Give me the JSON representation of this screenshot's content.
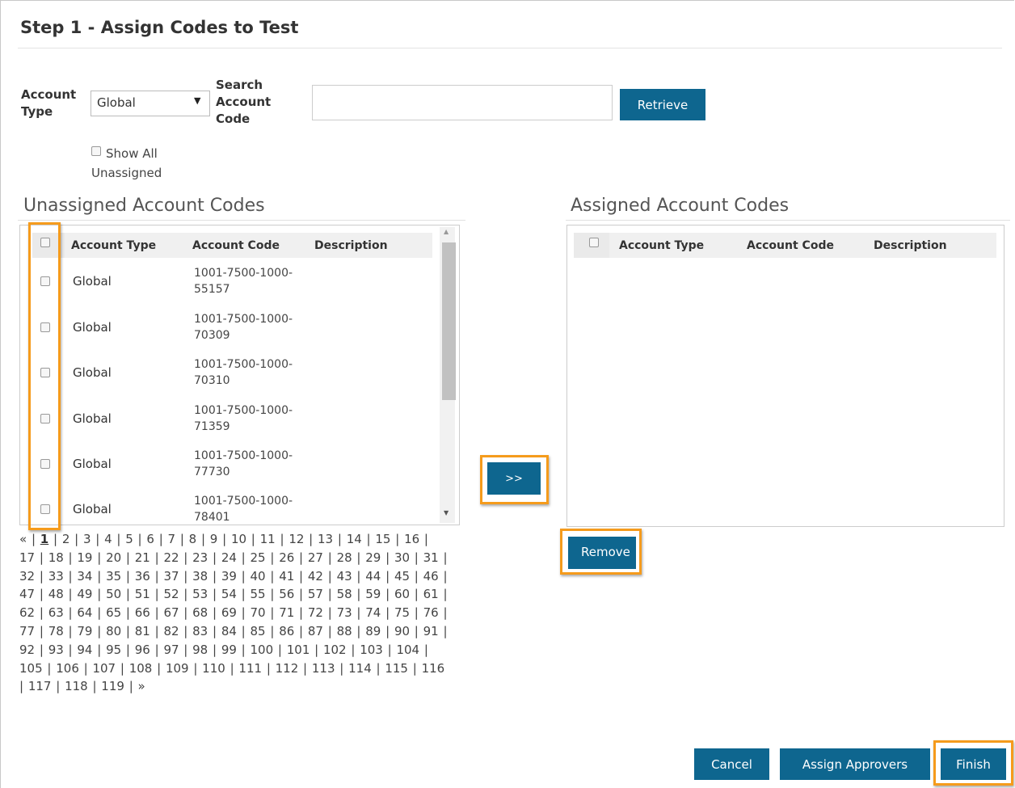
{
  "title": "Step 1 - Assign Codes to Test",
  "filters": {
    "account_type_label": "Account Type",
    "account_type_value": "Global",
    "search_label": "Search Account Code",
    "search_value": "",
    "retrieve_label": "Retrieve",
    "show_all_label": "Show All Unassigned"
  },
  "unassigned": {
    "heading": "Unassigned Account Codes",
    "columns": [
      "Account Type",
      "Account Code",
      "Description"
    ],
    "rows": [
      {
        "type": "Global",
        "code": "1001-7500-1000-55157",
        "description": ""
      },
      {
        "type": "Global",
        "code": "1001-7500-1000-70309",
        "description": ""
      },
      {
        "type": "Global",
        "code": "1001-7500-1000-70310",
        "description": ""
      },
      {
        "type": "Global",
        "code": "1001-7500-1000-71359",
        "description": ""
      },
      {
        "type": "Global",
        "code": "1001-7500-1000-77730",
        "description": ""
      },
      {
        "type": "Global",
        "code": "1001-7500-1000-78401",
        "description": ""
      }
    ]
  },
  "assigned": {
    "heading": "Assigned Account Codes",
    "columns": [
      "Account Type",
      "Account Code",
      "Description"
    ],
    "rows": []
  },
  "move_button_label": ">>",
  "remove_button_label": "Remove",
  "pagination": {
    "prev": "«",
    "next": "»",
    "current": 1,
    "total_pages": 119
  },
  "footer": {
    "cancel_label": "Cancel",
    "assign_approvers_label": "Assign Approvers",
    "finish_label": "Finish"
  },
  "colors": {
    "primary_button": "#0e668f",
    "highlight": "#f59b1c"
  }
}
